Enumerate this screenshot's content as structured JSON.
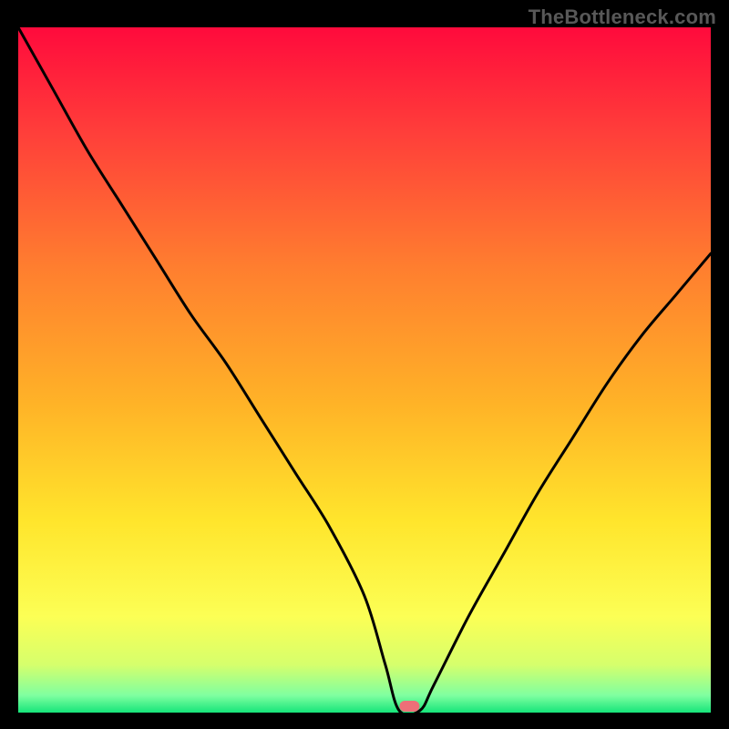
{
  "watermark": "TheBottleneck.com",
  "chart_data": {
    "type": "line",
    "title": "",
    "xlabel": "",
    "ylabel": "",
    "xlim": [
      1,
      21
    ],
    "ylim": [
      0,
      100
    ],
    "grid": false,
    "x": [
      1,
      2,
      3,
      4,
      5,
      6,
      7,
      8,
      9,
      10,
      11,
      11.6,
      12,
      12.6,
      13,
      14,
      15,
      16,
      17,
      18,
      19,
      20,
      21
    ],
    "values": [
      100,
      91,
      82,
      74,
      66,
      58,
      51,
      43,
      35,
      27,
      17,
      7,
      0.3,
      0.3,
      4,
      14,
      23,
      32,
      40,
      48,
      55,
      61,
      67
    ],
    "optimal_marker_x": 12.3,
    "gradient_name": "bottleneck-gradient",
    "gradient_stops": [
      {
        "offset": 0,
        "color": "#ff0a3c"
      },
      {
        "offset": 0.15,
        "color": "#ff3d3a"
      },
      {
        "offset": 0.35,
        "color": "#ff7e2f"
      },
      {
        "offset": 0.55,
        "color": "#ffb327"
      },
      {
        "offset": 0.72,
        "color": "#ffe52c"
      },
      {
        "offset": 0.86,
        "color": "#fcff55"
      },
      {
        "offset": 0.93,
        "color": "#d6ff6c"
      },
      {
        "offset": 0.975,
        "color": "#7fffa0"
      },
      {
        "offset": 1.0,
        "color": "#16e57a"
      }
    ],
    "marker_color": "#ee6f78"
  }
}
